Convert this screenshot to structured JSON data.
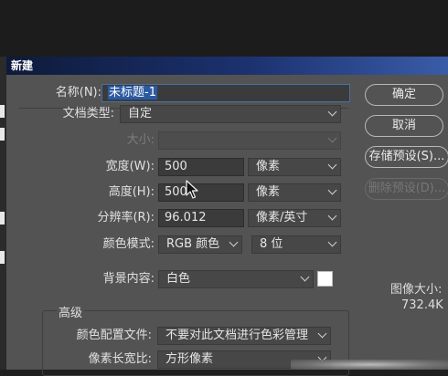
{
  "dialog": {
    "title": "新建",
    "fields": {
      "name": {
        "label": "名称(N):",
        "value": "未标题-1"
      },
      "doc_type": {
        "label": "文档类型:",
        "value": "自定"
      },
      "size": {
        "label": "大小:",
        "value": ""
      },
      "width": {
        "label": "宽度(W):",
        "value": "500",
        "unit": "像素"
      },
      "height": {
        "label": "高度(H):",
        "value": "500",
        "unit": "像素"
      },
      "resolution": {
        "label": "分辨率(R):",
        "value": "96.012",
        "unit": "像素/英寸"
      },
      "color_mode": {
        "label": "颜色模式:",
        "value": "RGB 颜色",
        "depth": "8 位"
      },
      "background": {
        "label": "背景内容:",
        "value": "白色",
        "swatch_color": "#ffffff"
      }
    },
    "advanced": {
      "title": "高级",
      "color_profile": {
        "label": "颜色配置文件:",
        "value": "不要对此文档进行色彩管理"
      },
      "pixel_aspect": {
        "label": "像素长宽比:",
        "value": "方形像素"
      }
    },
    "buttons": {
      "ok": "确定",
      "cancel": "取消",
      "save_preset": "存储预设(S)...",
      "delete_preset": "删除预设(D)..."
    },
    "image_size": {
      "label": "图像大小:",
      "value": "732.4K"
    }
  }
}
